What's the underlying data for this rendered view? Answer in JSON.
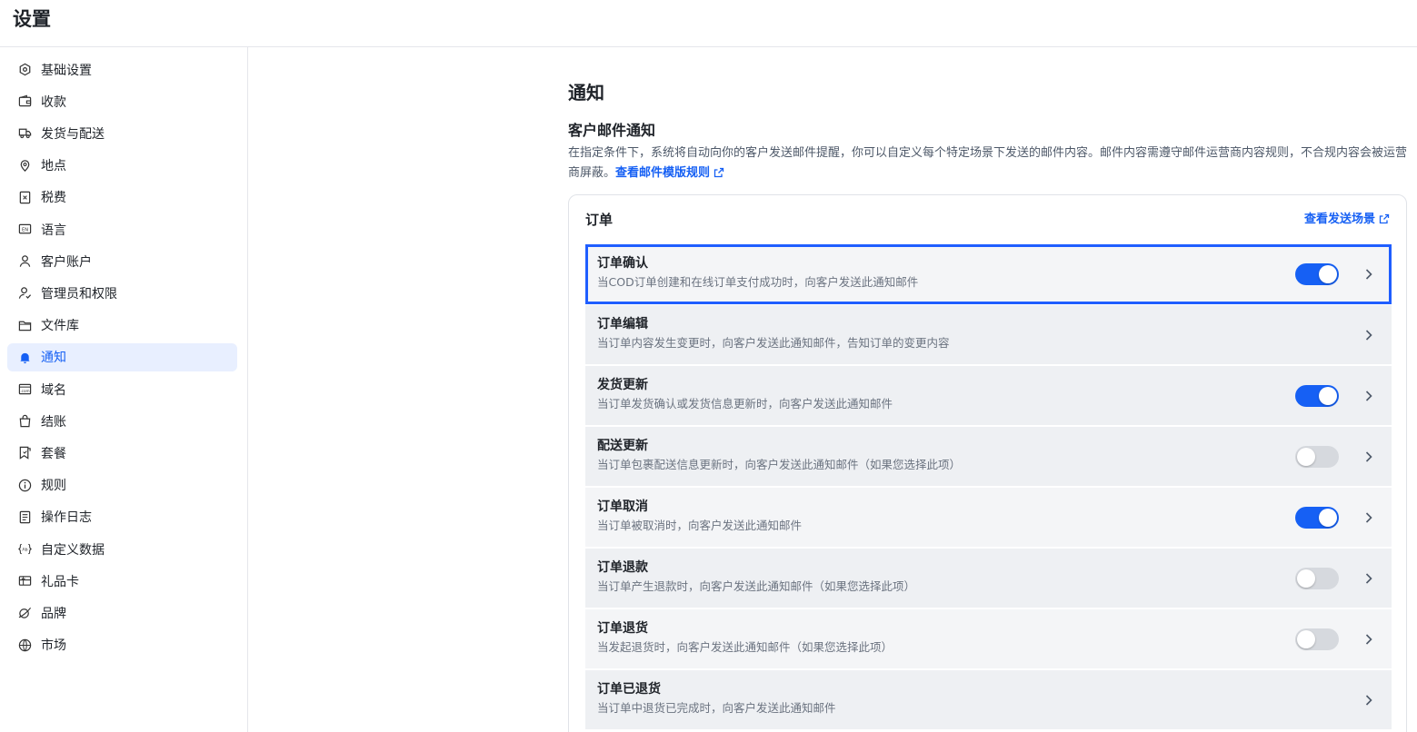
{
  "page": {
    "title": "设置"
  },
  "sidebar": {
    "items": [
      {
        "label": "基础设置",
        "icon": "hexagon-settings-icon",
        "active": false
      },
      {
        "label": "收款",
        "icon": "wallet-icon",
        "active": false
      },
      {
        "label": "发货与配送",
        "icon": "truck-icon",
        "active": false
      },
      {
        "label": "地点",
        "icon": "location-pin-icon",
        "active": false
      },
      {
        "label": "税费",
        "icon": "tax-receipt-icon",
        "active": false
      },
      {
        "label": "语言",
        "icon": "language-icon",
        "active": false
      },
      {
        "label": "客户账户",
        "icon": "user-icon",
        "active": false
      },
      {
        "label": "管理员和权限",
        "icon": "user-check-icon",
        "active": false
      },
      {
        "label": "文件库",
        "icon": "folder-icon",
        "active": false
      },
      {
        "label": "通知",
        "icon": "bell-icon",
        "active": true
      },
      {
        "label": "域名",
        "icon": "domain-icon",
        "active": false
      },
      {
        "label": "结账",
        "icon": "shopping-bag-icon",
        "active": false
      },
      {
        "label": "套餐",
        "icon": "plan-icon",
        "active": false
      },
      {
        "label": "规则",
        "icon": "info-icon",
        "active": false
      },
      {
        "label": "操作日志",
        "icon": "log-icon",
        "active": false
      },
      {
        "label": "自定义数据",
        "icon": "custom-data-icon",
        "active": false
      },
      {
        "label": "礼品卡",
        "icon": "gift-card-icon",
        "active": false
      },
      {
        "label": "品牌",
        "icon": "brand-icon",
        "active": false
      },
      {
        "label": "市场",
        "icon": "globe-icon",
        "active": false
      }
    ]
  },
  "main": {
    "heading": "通知",
    "section_title": "客户邮件通知",
    "description": "在指定条件下，系统将自动向你的客户发送邮件提醒，你可以自定义每个特定场景下发送的邮件内容。邮件内容需遵守邮件运营商内容规则，不合规内容会被运营商屏蔽。",
    "description_link": "查看邮件模版规则",
    "card": {
      "title": "订单",
      "link": "查看发送场景",
      "rows": [
        {
          "title": "订单确认",
          "subtitle": "当COD订单创建和在线订单支付成功时，向客户发送此通知邮件",
          "toggle": "on",
          "highlight": true
        },
        {
          "title": "订单编辑",
          "subtitle": "当订单内容发生变更时，向客户发送此通知邮件，告知订单的变更内容",
          "toggle": "none"
        },
        {
          "title": "发货更新",
          "subtitle": "当订单发货确认或发货信息更新时，向客户发送此通知邮件",
          "toggle": "on"
        },
        {
          "title": "配送更新",
          "subtitle": "当订单包裹配送信息更新时，向客户发送此通知邮件（如果您选择此项）",
          "toggle": "off"
        },
        {
          "title": "订单取消",
          "subtitle": "当订单被取消时，向客户发送此通知邮件",
          "toggle": "on"
        },
        {
          "title": "订单退款",
          "subtitle": "当订单产生退款时，向客户发送此通知邮件（如果您选择此项）",
          "toggle": "off"
        },
        {
          "title": "订单退货",
          "subtitle": "当发起退货时，向客户发送此通知邮件（如果您选择此项）",
          "toggle": "off"
        },
        {
          "title": "订单已退货",
          "subtitle": "当订单中退货已完成时，向客户发送此通知邮件",
          "toggle": "none"
        }
      ]
    }
  },
  "colors": {
    "accent": "#1660f4",
    "highlight_border": "#1f5eff",
    "active_bg": "#e8efff"
  }
}
